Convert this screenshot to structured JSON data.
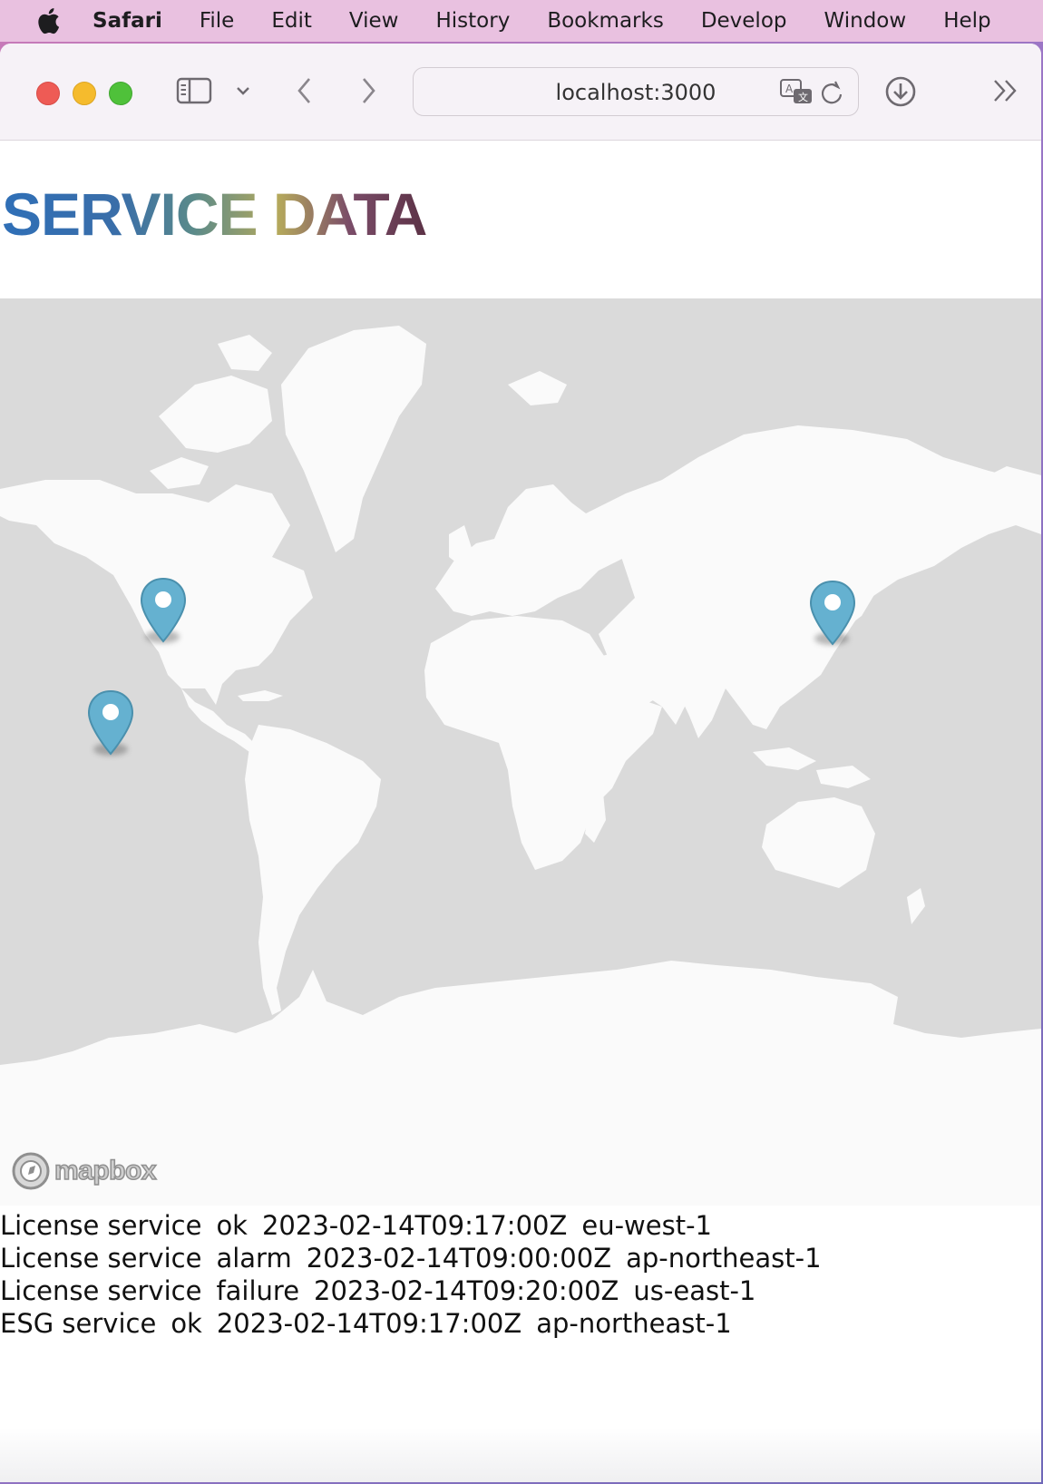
{
  "menubar": {
    "app_name": "Safari",
    "items": [
      "File",
      "Edit",
      "View",
      "History",
      "Bookmarks",
      "Develop",
      "Window",
      "Help"
    ]
  },
  "toolbar": {
    "url": "localhost:3000"
  },
  "page": {
    "title": "SERVICE DATA"
  },
  "map": {
    "attribution": "mapbox",
    "markers": [
      {
        "name": "marker-us-west",
        "color": "#65b1d0"
      },
      {
        "name": "marker-pacific",
        "color": "#65b1d0"
      },
      {
        "name": "marker-japan",
        "color": "#65b1d0"
      }
    ]
  },
  "services": [
    {
      "name": "License service",
      "status": "ok",
      "time": "2023-02-14T09:17:00Z",
      "region": "eu-west-1"
    },
    {
      "name": "License service",
      "status": "alarm",
      "time": "2023-02-14T09:00:00Z",
      "region": "ap-northeast-1"
    },
    {
      "name": "License service",
      "status": "failure",
      "time": "2023-02-14T09:20:00Z",
      "region": "us-east-1"
    },
    {
      "name": "ESG service",
      "status": "ok",
      "time": "2023-02-14T09:17:00Z",
      "region": "ap-northeast-1"
    }
  ],
  "colors": {
    "marker": "#65b1d0",
    "land": "#fafafa",
    "water": "#dadada"
  }
}
